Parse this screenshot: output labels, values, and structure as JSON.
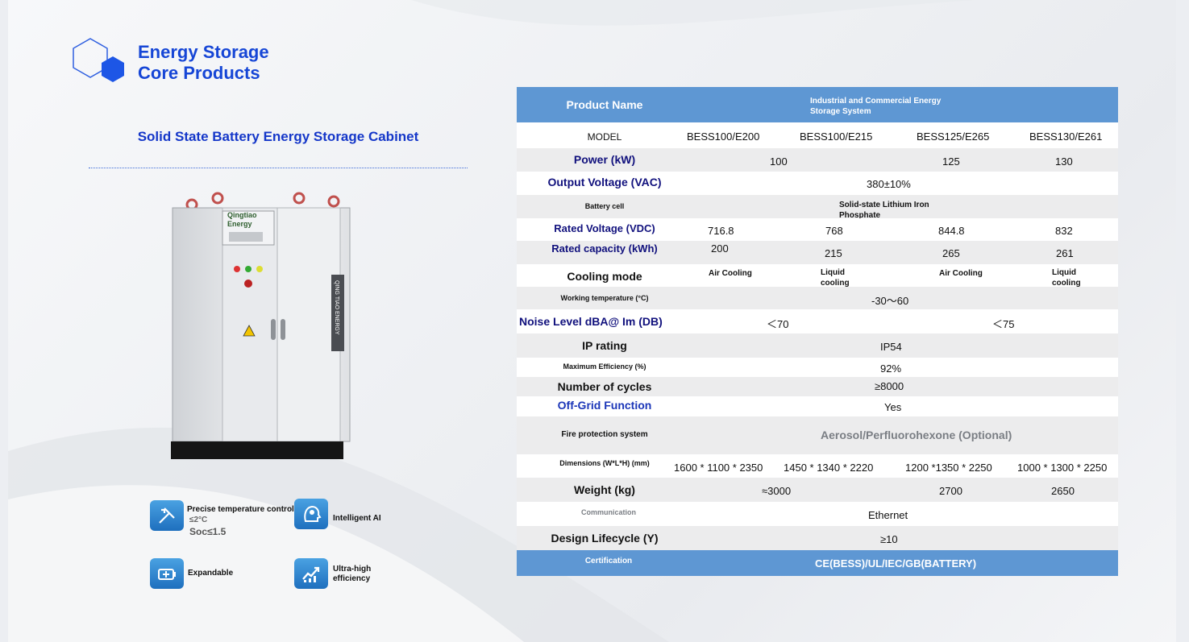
{
  "header": {
    "brand_line1": "Energy Storage",
    "brand_line2": "Core Products"
  },
  "product": {
    "title": "Solid State Battery Energy Storage Cabinet",
    "cabinet_brand_line1": "Qingtiao",
    "cabinet_brand_line2": "Energy",
    "cabinet_side_text": "QING TIAO ENERGY"
  },
  "features": [
    {
      "label": "Precise temperature control",
      "extra1": "≤2°C",
      "extra2": "Soc≤1.5",
      "icon": "tools-icon"
    },
    {
      "label": "Intelligent AI",
      "icon": "ai-head-icon"
    },
    {
      "label": "Expandable",
      "icon": "battery-plus-icon"
    },
    {
      "label": "Ultra-high efficiency",
      "line1": "Ultra-high",
      "line2": "efficiency",
      "icon": "growth-chart-icon"
    }
  ],
  "table": {
    "header": {
      "label": "Product Name",
      "value_line1": "Industrial and Commercial Energy",
      "value_line2": "Storage System"
    },
    "model": {
      "label": "MODEL",
      "values": [
        "BESS100/E200",
        "BESS100/E215",
        "BESS125/E265",
        "BESS130/E261"
      ]
    },
    "power": {
      "label": "Power (kW)",
      "values": [
        "100",
        "125",
        "130"
      ]
    },
    "output_voltage": {
      "label": "Output Voltage (VAC)",
      "value": "380±10%"
    },
    "battery_cell": {
      "label": "Battery cell",
      "value_line1": "Solid-state Lithium Iron",
      "value_line2": "Phosphate"
    },
    "rated_voltage": {
      "label": "Rated Voltage (VDC)",
      "values": [
        "716.8",
        "768",
        "844.8",
        "832"
      ]
    },
    "rated_capacity": {
      "label": "Rated capacity (kWh)",
      "values": [
        "200",
        "215",
        "265",
        "261"
      ]
    },
    "cooling": {
      "label": "Cooling mode",
      "values": [
        "Air Cooling",
        "Liquid cooling",
        "Air Cooling",
        "Liquid cooling"
      ],
      "liquid_line1": "Liquid",
      "liquid_line2": "cooling"
    },
    "working_temp": {
      "label": "Working temperature (°C)",
      "value": "-30～60"
    },
    "noise": {
      "label": "Noise Level dBA@ Im (DB)",
      "values": [
        "＜70",
        "＜75"
      ]
    },
    "ip": {
      "label": "IP rating",
      "value": "IP54"
    },
    "efficiency": {
      "label": "Maximum Efficiency (%)",
      "value": "92%"
    },
    "cycles": {
      "label": "Number of cycles",
      "value": "≥8000"
    },
    "offgrid": {
      "label": "Off-Grid Function",
      "value": "Yes"
    },
    "fire": {
      "label": "Fire protection system",
      "value": "Aerosol/Perfluorohexone (Optional)"
    },
    "dimensions": {
      "label": "Dimensions (W*L*H) (mm)",
      "values": [
        "1600 * 1100 * 2350",
        "1450 * 1340 * 2220",
        "1200 *1350 * 2250",
        "1000 * 1300 * 2250"
      ]
    },
    "weight": {
      "label": "Weight (kg)",
      "values": [
        "≈3000",
        "2700",
        "2650"
      ]
    },
    "communication": {
      "label": "Communication",
      "value": "Ethernet"
    },
    "lifecycle": {
      "label": "Design Lifecycle (Y)",
      "value": "≥10"
    },
    "certification": {
      "label": "Certification",
      "value": "CE(BESS)/UL/IEC/GB(BATTERY)"
    }
  },
  "colors": {
    "brand_blue": "#1646d6",
    "header_blue": "#5e97d3",
    "navy": "#11117d",
    "row_gray": "#ececed"
  }
}
